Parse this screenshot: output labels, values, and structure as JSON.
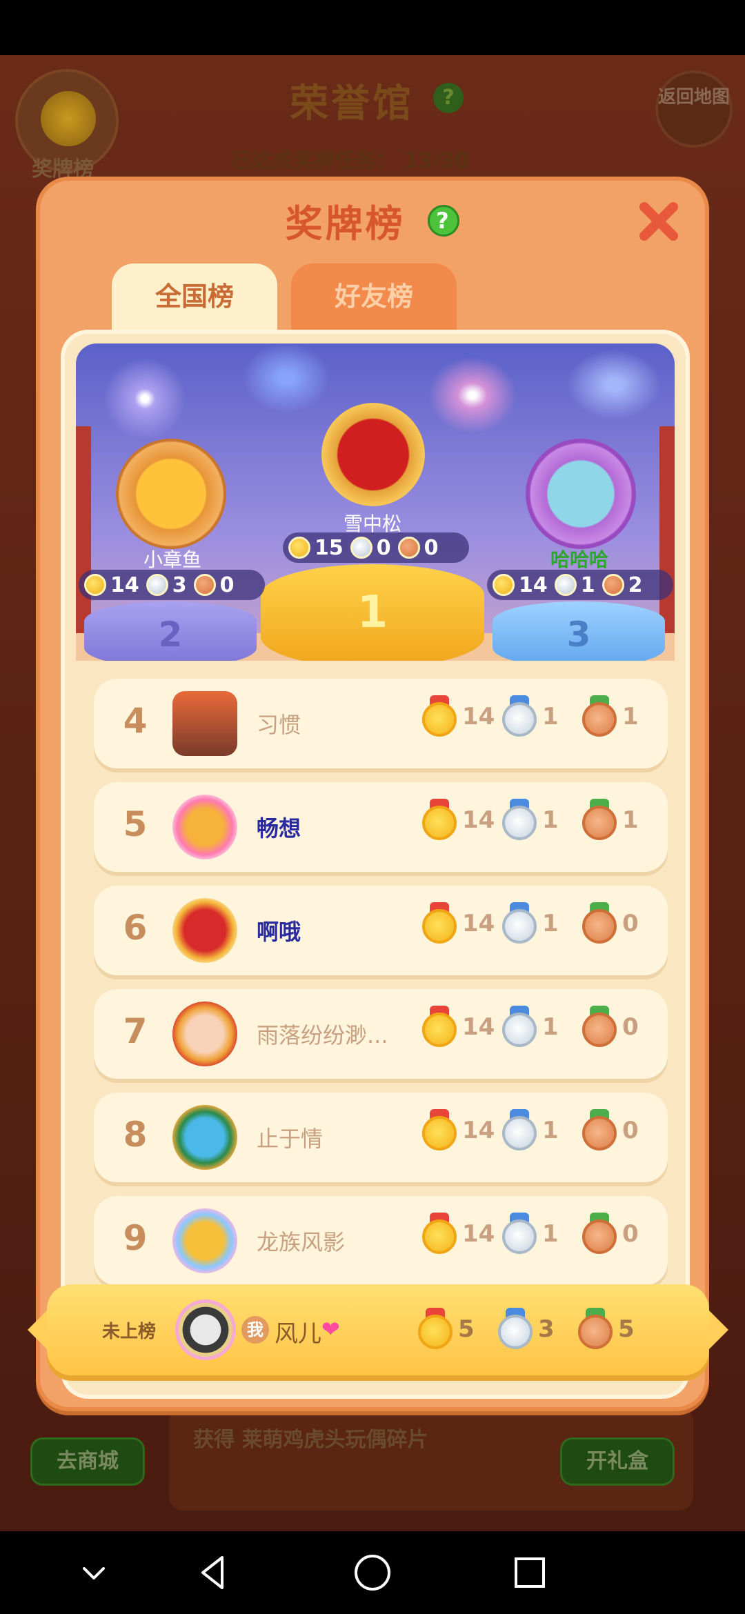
{
  "background": {
    "title": "荣誉馆",
    "progress_label": "已达成奖牌任务：",
    "progress_value": "13/30",
    "medal_board_label": "奖牌榜",
    "return_label": "返回地图",
    "reward_text": "获得 莱萌鸡虎头玩偶碎片",
    "shop_button": "去商城",
    "gift_button": "开礼盒"
  },
  "modal": {
    "title": "奖牌榜",
    "help": "?",
    "tabs": [
      {
        "label": "全国榜",
        "active": true
      },
      {
        "label": "好友榜",
        "active": false
      }
    ]
  },
  "podium": {
    "first": {
      "rank": "1",
      "name": "雪中松",
      "gold": "15",
      "silver": "0",
      "bronze": "0"
    },
    "second": {
      "rank": "2",
      "name": "小章鱼",
      "gold": "14",
      "silver": "3",
      "bronze": "0"
    },
    "third": {
      "rank": "3",
      "name": "哈哈哈",
      "gold": "14",
      "silver": "1",
      "bronze": "2"
    }
  },
  "rows": [
    {
      "rank": "4",
      "name": "习惯",
      "gold": "14",
      "silver": "1",
      "bronze": "1"
    },
    {
      "rank": "5",
      "name": "畅想",
      "gold": "14",
      "silver": "1",
      "bronze": "1"
    },
    {
      "rank": "6",
      "name": "啊哦",
      "gold": "14",
      "silver": "1",
      "bronze": "0"
    },
    {
      "rank": "7",
      "name": "雨落纷纷渺...",
      "gold": "14",
      "silver": "1",
      "bronze": "0"
    },
    {
      "rank": "8",
      "name": "止于情",
      "gold": "14",
      "silver": "1",
      "bronze": "0"
    },
    {
      "rank": "9",
      "name": "龙族风影",
      "gold": "14",
      "silver": "1",
      "bronze": "0"
    }
  ],
  "self": {
    "rank_label": "未上榜",
    "me_badge": "我",
    "name": "风儿",
    "gold": "5",
    "silver": "3",
    "bronze": "5"
  },
  "colors": {
    "modal_bg": "#f3a267",
    "title": "#d8572a",
    "gold": "#f4b21a",
    "silver": "#c4d2de",
    "bronze": "#dc7d45"
  }
}
